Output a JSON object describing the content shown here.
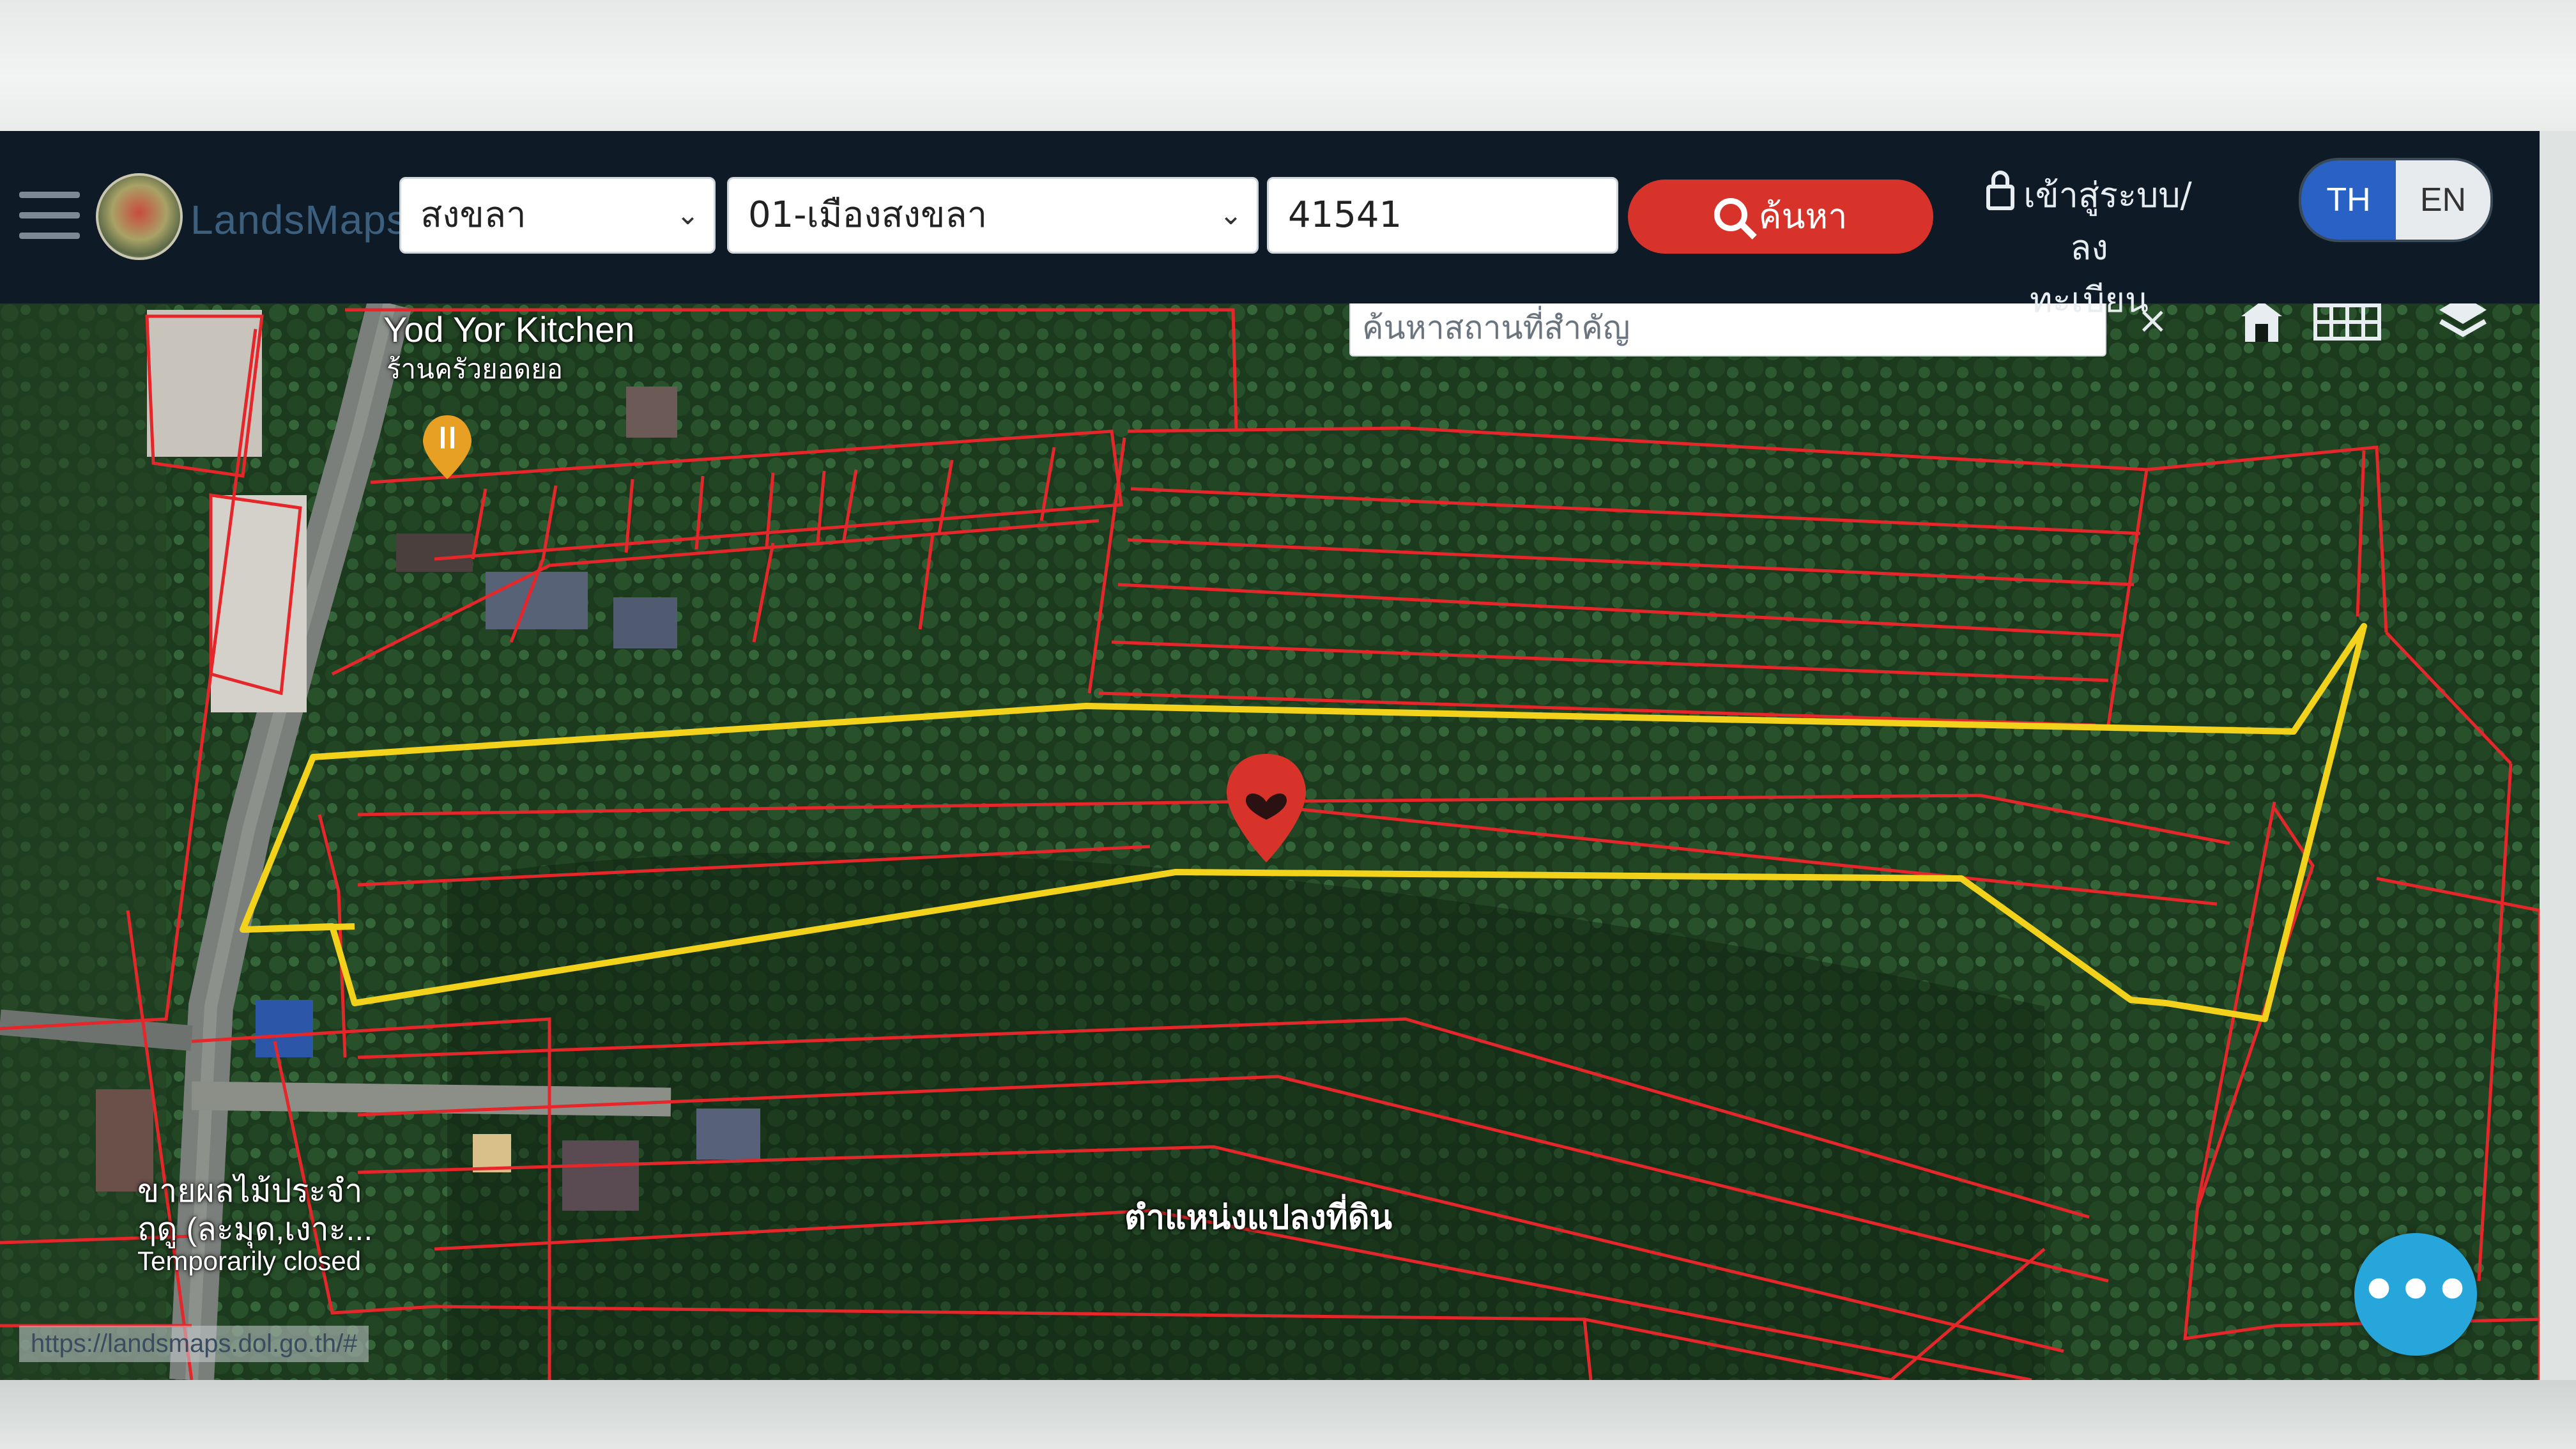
{
  "navbar": {
    "logo_text": "LandsMaps",
    "province": "สงขลา",
    "district": "01-เมืองสงขลา",
    "parcel_no": "41541",
    "search_label": "ค้นหา",
    "login_line1": "เข้าสู่ระบบ/ลง",
    "login_line2": "ทะเบียน",
    "lang_th": "TH",
    "lang_en": "EN",
    "active_lang": "TH"
  },
  "map": {
    "place_search_placeholder": "ค้นหาสถานที่สำคัญ",
    "clear_icon": "close-icon",
    "poi_name": "Yod Yor Kitchen",
    "poi_name_th": "ร้านครัวยอดยอ",
    "shop_name_line1": "ขายผลไม้ประจำ",
    "shop_name_line2": "ฤดู (ละมุด,เงาะ...",
    "shop_status": "Temporarily closed",
    "parcel_marker_label": "ตำแหน่งแปลงที่ดิน",
    "status_url": "https://landsmaps.dol.go.th/#",
    "colors": {
      "parcel_boundary": "#e5262a",
      "selected_parcel": "#f2d21a",
      "marker": "#d8332b"
    }
  },
  "icons": {
    "menu": "hamburger-icon",
    "home": "building-icon",
    "grid": "grid-icon",
    "layers": "layers-icon",
    "chat": "more-dots-icon"
  }
}
